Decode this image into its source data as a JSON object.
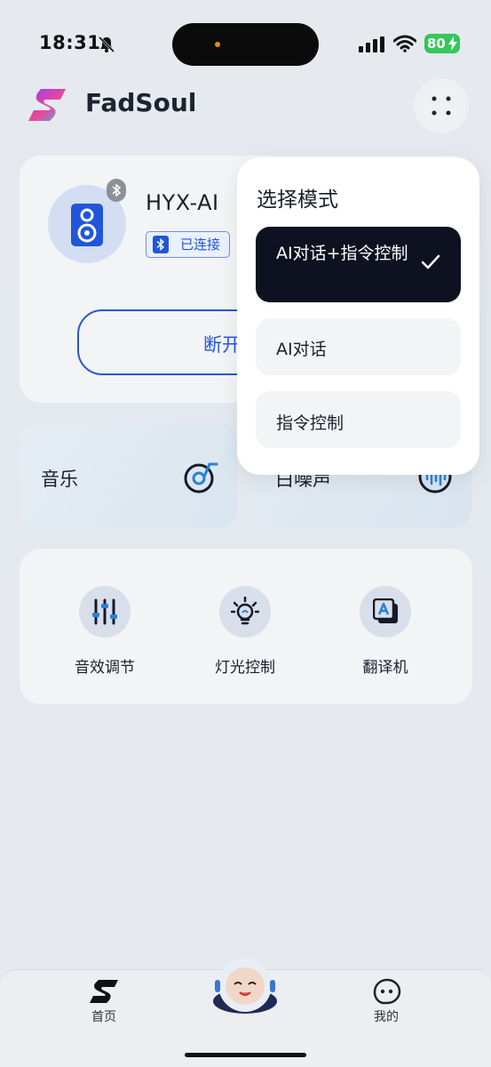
{
  "status_bar": {
    "time": "18:31",
    "battery": "80",
    "icons": [
      "bell-slash-icon",
      "signal-icon",
      "wifi-icon",
      "battery-charging-icon"
    ]
  },
  "header": {
    "brand": "FadSoul",
    "menu_icon": "four-dots-icon"
  },
  "device": {
    "name": "HYX-AI",
    "status": "已连接",
    "disconnect_label": "断开",
    "icon": "speaker-icon"
  },
  "quick_cards": [
    {
      "label": "音乐",
      "icon": "music-disc-icon"
    },
    {
      "label": "白噪声",
      "icon": "waveform-icon"
    }
  ],
  "tools": [
    {
      "label": "音效调节",
      "icon": "equalizer-icon"
    },
    {
      "label": "灯光控制",
      "icon": "lightbulb-icon"
    },
    {
      "label": "翻译机",
      "icon": "translate-icon"
    }
  ],
  "mode_popup": {
    "title": "选择模式",
    "options": [
      {
        "label": "AI对话+指令控制",
        "selected": true
      },
      {
        "label": "AI对话",
        "selected": false
      },
      {
        "label": "指令控制",
        "selected": false
      }
    ]
  },
  "tabbar": {
    "home": "首页",
    "mine": "我的"
  },
  "colors": {
    "accent": "#2a55d8",
    "selected_option": "#0e1120",
    "battery": "#34c759"
  }
}
